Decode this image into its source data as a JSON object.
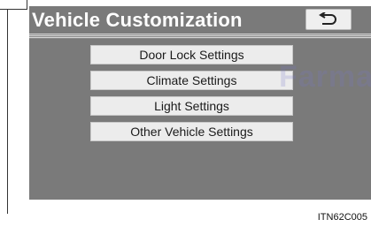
{
  "screen": {
    "title": "Vehicle Customization",
    "back_icon": "back-arrow-icon",
    "background": "#7a7a7a"
  },
  "menu": {
    "items": [
      {
        "label": "Door Lock Settings"
      },
      {
        "label": "Climate Settings"
      },
      {
        "label": "Light Settings"
      },
      {
        "label": "Other Vehicle Settings"
      }
    ]
  },
  "watermark": "FarmaSC",
  "caption": "ITN62C005"
}
